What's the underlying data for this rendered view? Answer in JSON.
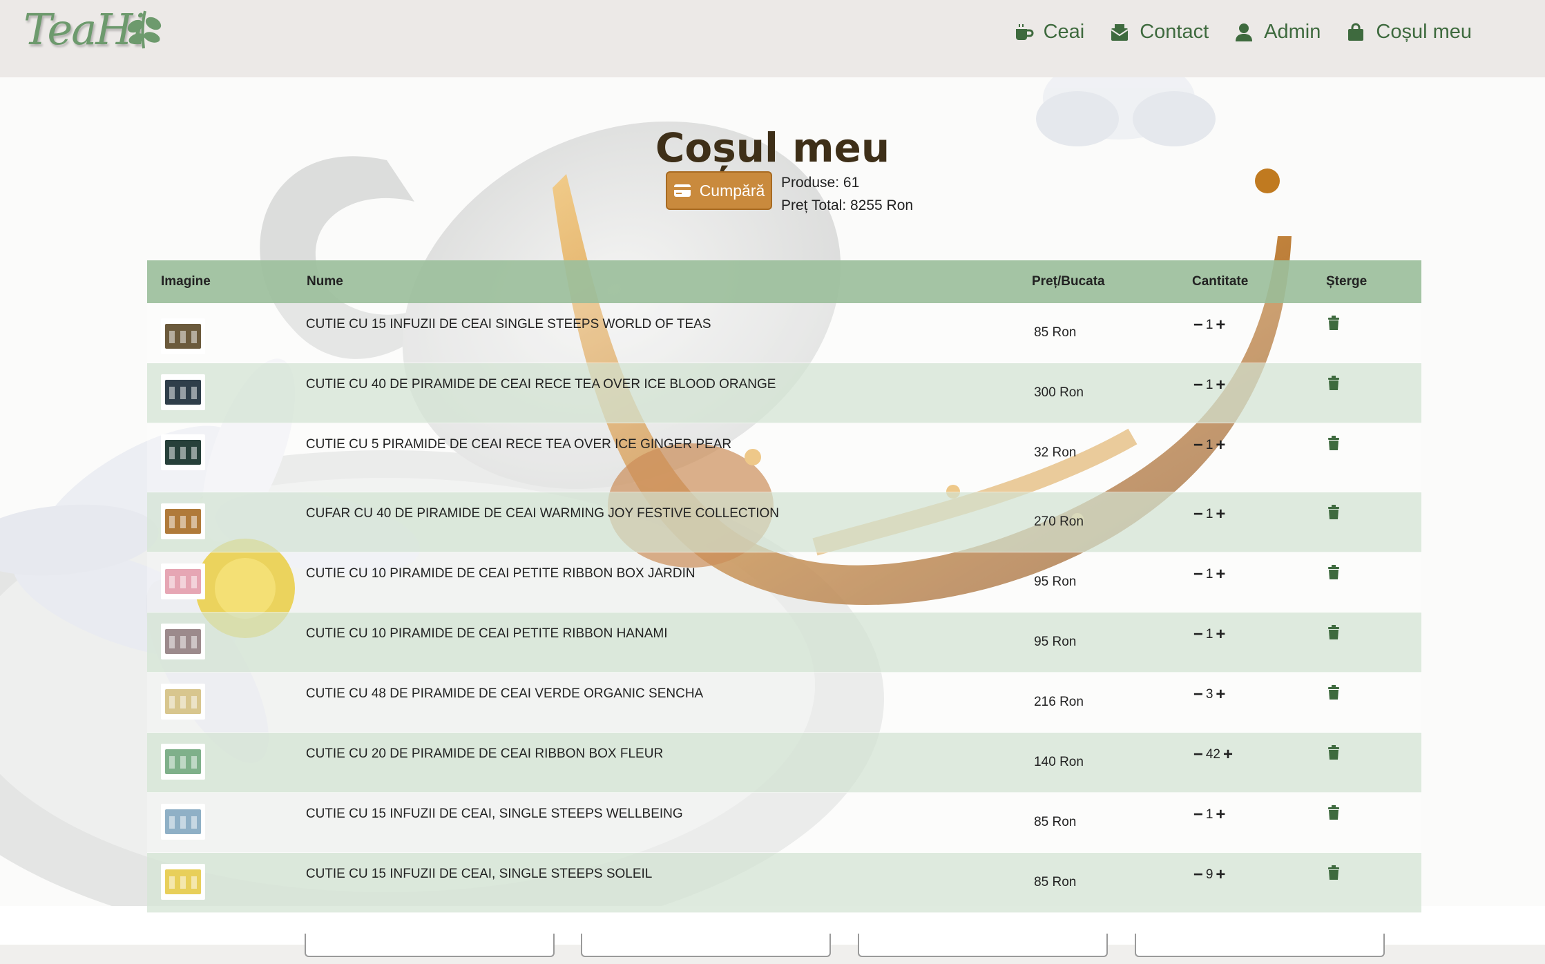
{
  "header": {
    "logo_text": "TeaHi",
    "nav": [
      {
        "label": "Ceai",
        "icon": "mug-icon"
      },
      {
        "label": "Contact",
        "icon": "envelope-icon"
      },
      {
        "label": "Admin",
        "icon": "user-icon"
      },
      {
        "label": "Coșul meu",
        "icon": "shopping-bag-icon"
      }
    ]
  },
  "cart": {
    "title": "Coșul meu",
    "buy_label": "Cumpără",
    "products_count": "Produse: 61",
    "total_price": "Preț Total: 8255 Ron"
  },
  "table": {
    "headers": {
      "image": "Imagine",
      "name": "Nume",
      "price": "Preț/Bucata",
      "quantity": "Cantitate",
      "delete": "Șterge"
    },
    "rows": [
      {
        "name": "CUTIE CU 15 INFUZII DE CEAI SINGLE STEEPS WORLD OF TEAS",
        "price": "85 Ron",
        "qty": "1",
        "thumb_color": "#6b5a3c"
      },
      {
        "name": "CUTIE CU 40 DE PIRAMIDE DE CEAI RECE TEA OVER ICE BLOOD ORANGE",
        "price": "300 Ron",
        "qty": "1",
        "thumb_color": "#2f3e4a"
      },
      {
        "name": "CUTIE CU 5 PIRAMIDE DE CEAI RECE TEA OVER ICE GINGER PEAR",
        "price": "32 Ron",
        "qty": "1",
        "thumb_color": "#27403a"
      },
      {
        "name": "CUFAR CU 40 DE PIRAMIDE DE CEAI WARMING JOY FESTIVE COLLECTION",
        "price": "270 Ron",
        "qty": "1",
        "thumb_color": "#b07a3a"
      },
      {
        "name": "CUTIE CU 10 PIRAMIDE DE CEAI PETITE RIBBON BOX JARDIN",
        "price": "95 Ron",
        "qty": "1",
        "thumb_color": "#e6a6b4"
      },
      {
        "name": "CUTIE CU 10 PIRAMIDE DE CEAI PETITE RIBBON HANAMI",
        "price": "95 Ron",
        "qty": "1",
        "thumb_color": "#9c8a8c"
      },
      {
        "name": "CUTIE CU 48 DE PIRAMIDE DE CEAI VERDE ORGANIC SENCHA",
        "price": "216 Ron",
        "qty": "3",
        "thumb_color": "#d8c68e"
      },
      {
        "name": "CUTIE CU 20 DE PIRAMIDE DE CEAI RIBBON BOX FLEUR",
        "price": "140 Ron",
        "qty": "42",
        "thumb_color": "#7fb08a"
      },
      {
        "name": "CUTIE CU 15 INFUZII DE CEAI, SINGLE STEEPS WELLBEING",
        "price": "85 Ron",
        "qty": "1",
        "thumb_color": "#8fb0c6"
      },
      {
        "name": "CUTIE CU 15 INFUZII DE CEAI, SINGLE STEEPS SOLEIL",
        "price": "85 Ron",
        "qty": "9",
        "thumb_color": "#e8cf5a"
      }
    ]
  },
  "colors": {
    "accent_green": "#3e6a3e",
    "header_bg": "#ece9e7",
    "buy_button": "#c98a3d",
    "table_header": "#9cbf9c"
  }
}
